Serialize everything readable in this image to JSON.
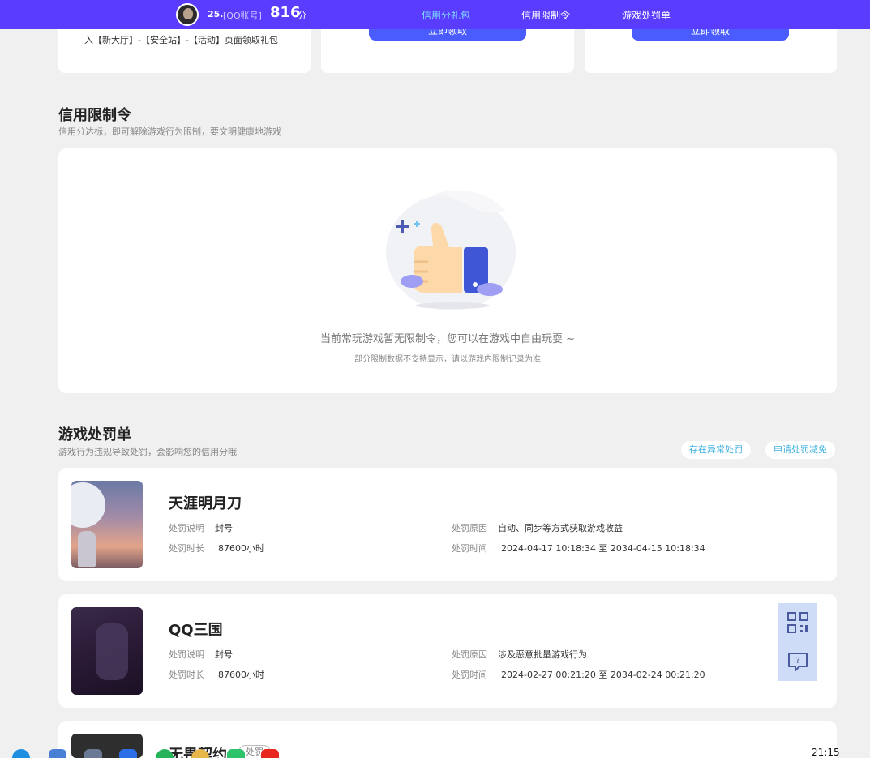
{
  "header": {
    "user_num": "25.",
    "account_type": "[QQ账号]",
    "score": "816",
    "score_unit": "分",
    "nav": [
      "信用分礼包",
      "信用限制令",
      "游戏处罚单"
    ],
    "active_nav": "信用分礼包"
  },
  "gift_cards": {
    "card1_text": "入【新大厅】-【安全站】-【活动】页面领取礼包",
    "claim_label": "立即领取"
  },
  "restriction": {
    "title": "信用限制令",
    "subtitle": "信用分达标，即可解除游戏行为限制，要文明健康地游戏",
    "empty_message": "当前常玩游戏暂无限制令，您可以在游戏中自由玩耍 ~",
    "empty_note": "部分限制数据不支持显示，请以游戏内限制记录为准"
  },
  "penalty": {
    "title": "游戏处罚单",
    "subtitle": "游戏行为违规导致处罚，会影响您的信用分哦",
    "btn_dispute": "存在异常处罚",
    "btn_reduce": "申请处罚减免",
    "labels": {
      "desc": "处罚说明",
      "reason": "处罚原因",
      "duration": "处罚时长",
      "time": "处罚时间"
    },
    "items": [
      {
        "game": "天涯明月刀",
        "desc": "封号",
        "reason": "自动、同步等方式获取游戏收益",
        "duration": "87600小时",
        "time": "2024-04-17 10:18:34 至 2034-04-15 10:18:34"
      },
      {
        "game": "QQ三国",
        "desc": "封号",
        "reason": "涉及恶意批量游戏行为",
        "duration": "87600小时",
        "time": "2024-02-27 00:21:20 至 2034-02-24 00:21:20"
      },
      {
        "game": "无畏契约",
        "tag": "处罚"
      }
    ]
  },
  "taskbar": {
    "time": "21:15"
  },
  "colors": {
    "brand": "#5a3cff",
    "button": "#4b5cff",
    "accent": "#3db0e0"
  }
}
